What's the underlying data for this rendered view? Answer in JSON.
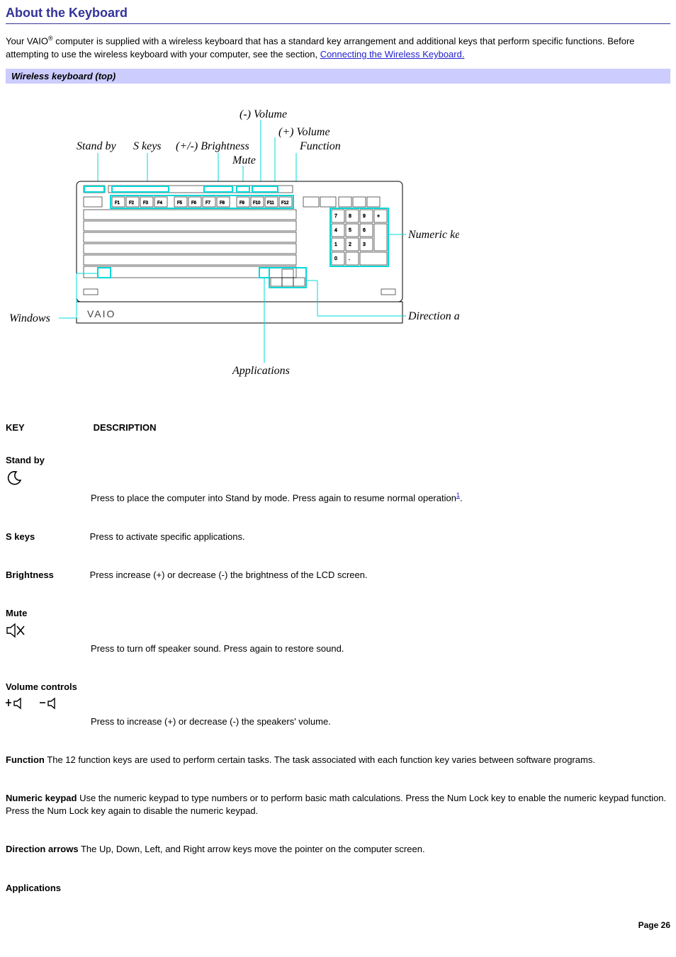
{
  "title": "About the Keyboard",
  "intro_a": "Your VAIO",
  "intro_b": " computer is supplied with a wireless keyboard that has a standard key arrangement and additional keys that perform specific functions. Before attempting to use the wireless keyboard with your computer, see the section, ",
  "intro_link": "Connecting the Wireless Keyboard.",
  "caption": "Wireless keyboard (top)",
  "diagram": {
    "labels": {
      "standby": "Stand by",
      "skeys": "S keys",
      "brightness": "(+/-) Brightness",
      "mute": "Mute",
      "vol_minus": "(-) Volume",
      "vol_plus": "(+) Volume",
      "function": "Function",
      "numeric": "Numeric keypad",
      "direction": "Direction arrows",
      "windows": "Windows",
      "applications": "Applications",
      "logo": "VAIO"
    }
  },
  "table_head": {
    "key": "KEY",
    "desc": "DESCRIPTION"
  },
  "rows": {
    "standby": {
      "label": "Stand by",
      "desc": "Press to place the computer into Stand by mode. Press again to resume normal operation",
      "sup": "1",
      "tail": "."
    },
    "skeys": {
      "label": "S keys",
      "desc": "Press to activate specific applications."
    },
    "brightness": {
      "label": "Brightness",
      "desc": "Press increase (+) or decrease (-) the brightness of the LCD screen."
    },
    "mute": {
      "label": "Mute",
      "desc": "Press to turn off speaker sound. Press again to restore sound."
    },
    "volume": {
      "label": "Volume controls",
      "desc": "Press to increase (+) or decrease (-) the speakers' volume."
    },
    "function": {
      "label": "Function",
      "desc": "The 12 function keys are used to perform certain tasks. The task associated with each function key varies between software programs."
    },
    "numeric": {
      "label": "Numeric keypad",
      "desc": "Use the numeric keypad to type numbers or to perform basic math calculations. Press the Num Lock key to enable the numeric keypad function. Press the Num Lock key again to disable the numeric keypad."
    },
    "direction": {
      "label": "Direction arrows",
      "desc": "The Up, Down, Left, and Right arrow keys move the pointer on the computer screen."
    },
    "applications": {
      "label": "Applications"
    }
  },
  "page": "Page 26"
}
